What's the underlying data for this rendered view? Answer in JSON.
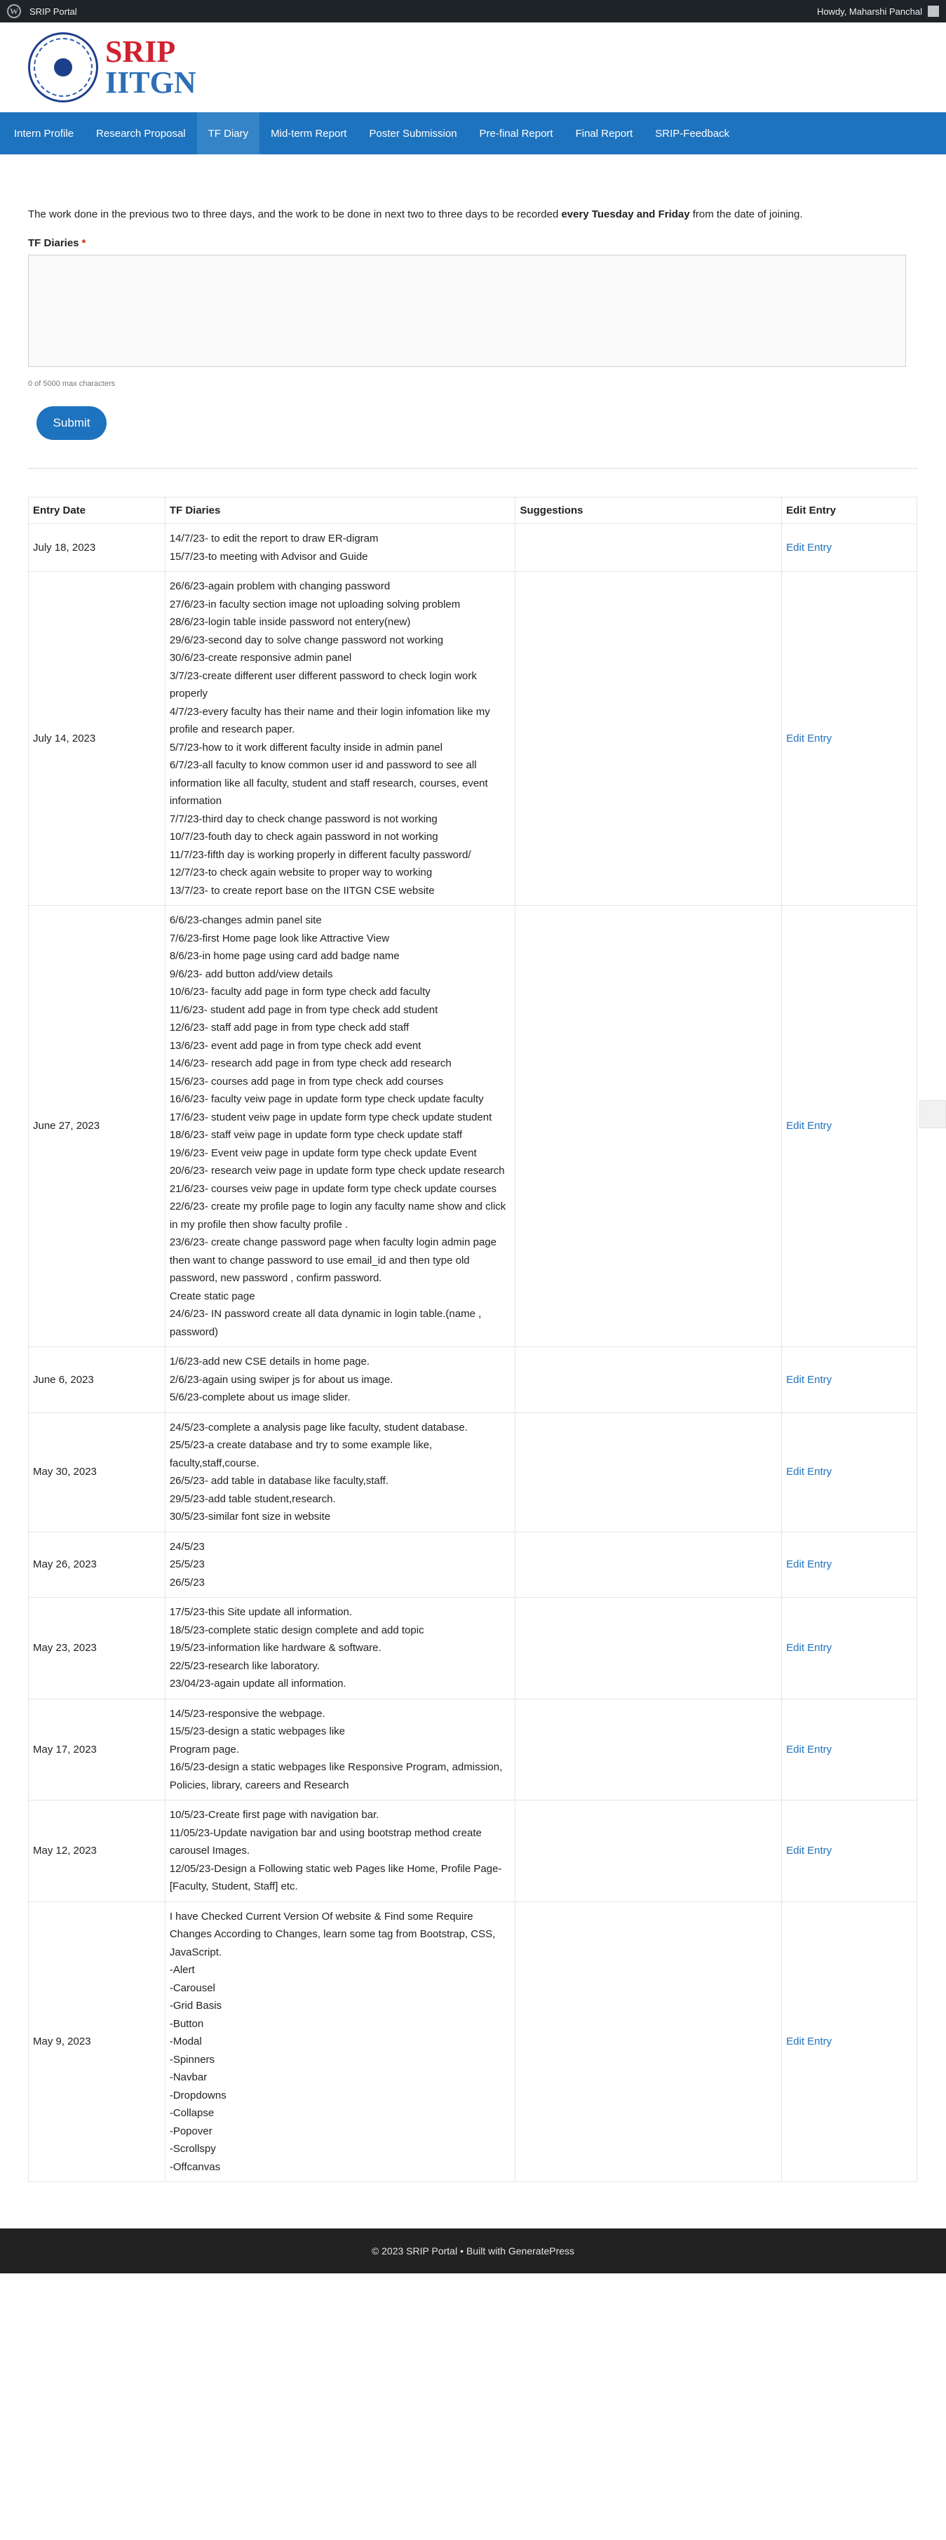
{
  "adminbar": {
    "site_name": "SRIP Portal",
    "greeting": "Howdy, Maharshi Panchal"
  },
  "header": {
    "logo_line1": "SRIP",
    "logo_line2": "IITGN"
  },
  "nav": [
    {
      "label": "Intern Profile"
    },
    {
      "label": "Research Proposal"
    },
    {
      "label": "TF Diary",
      "active": true
    },
    {
      "label": "Mid-term Report"
    },
    {
      "label": "Poster Submission"
    },
    {
      "label": "Pre-final Report"
    },
    {
      "label": "Final Report"
    },
    {
      "label": "SRIP-Feedback"
    }
  ],
  "form": {
    "intro_pre": "The work done in the previous two to three days, and the work to be done in next two to three days to be recorded ",
    "intro_bold": "every Tuesday and Friday",
    "intro_post": " from the date of joining.",
    "field_label": "TF Diaries",
    "required_mark": "*",
    "char_count": "0 of 5000 max characters",
    "submit_label": "Submit"
  },
  "table": {
    "headers": [
      "Entry Date",
      "TF Diaries",
      "Suggestions",
      "Edit Entry"
    ],
    "edit_label": "Edit Entry",
    "rows": [
      {
        "date": "July 18, 2023",
        "lines": [
          "14/7/23- to edit the report to draw ER-digram",
          "15/7/23-to meeting with Advisor and Guide"
        ]
      },
      {
        "date": "July 14, 2023",
        "lines": [
          "26/6/23-again problem with changing password",
          "27/6/23-in faculty section image not uploading solving problem",
          "28/6/23-login table inside password not entery(new)",
          "29/6/23-second day to solve change password not working",
          "30/6/23-create responsive admin panel",
          "3/7/23-create different user different password to check login work properly",
          "4/7/23-every faculty has their name and their login infomation like my profile and research paper.",
          "5/7/23-how to it work different faculty inside in admin panel",
          "6/7/23-all faculty to know common user id and password to see all information like all faculty, student and staff research, courses, event information",
          "7/7/23-third day to check change password is not working",
          "10/7/23-fouth day to check again password in not working",
          "11/7/23-fifth day is working properly in different faculty password/",
          "12/7/23-to check again website to proper way to working",
          "13/7/23- to create report base on the IITGN CSE website"
        ]
      },
      {
        "date": "June 27, 2023",
        "lines": [
          "6/6/23-changes admin panel site",
          "7/6/23-first Home page look like Attractive View",
          "8/6/23-in home page using card add badge name",
          "9/6/23- add button add/view details",
          "10/6/23- faculty add page in form type check add faculty",
          "11/6/23- student add page in from type check add student",
          "12/6/23- staff add page in from type check add staff",
          "13/6/23- event add page in from type check add event",
          "14/6/23- research add page in from type check add research",
          "15/6/23- courses add page in from type check add courses",
          "16/6/23- faculty veiw page in update form type check update faculty",
          "17/6/23- student veiw page in update form type check update student",
          "18/6/23- staff veiw page in update form type check update staff",
          "19/6/23- Event veiw page in update form type check update Event",
          "20/6/23- research veiw page in update form type check update research",
          "21/6/23- courses veiw page in update form type check update courses",
          "22/6/23- create my profile page to login any faculty name show and click in my profile then show faculty profile .",
          "23/6/23- create change password page when faculty login admin page then want to change password to use email_id and then type old password, new password , confirm password.",
          "Create static page",
          "24/6/23- IN password create all data dynamic in login table.(name , password)"
        ]
      },
      {
        "date": "June 6, 2023",
        "lines": [
          "1/6/23-add new CSE details in home page.",
          "2/6/23-again using swiper js for about us image.",
          "5/6/23-complete about us image slider."
        ]
      },
      {
        "date": "May 30, 2023",
        "lines": [
          "24/5/23-complete a analysis page like faculty, student database.",
          "25/5/23-a create database and try to some example like, faculty,staff,course.",
          "26/5/23- add table in database like faculty,staff.",
          "29/5/23-add table student,research.",
          "30/5/23-similar font size in website"
        ]
      },
      {
        "date": "May 26, 2023",
        "lines": [
          "24/5/23",
          "25/5/23",
          "26/5/23"
        ]
      },
      {
        "date": "May 23, 2023",
        "lines": [
          "17/5/23-this Site update all information.",
          "18/5/23-complete static design complete and add topic",
          "19/5/23-information like hardware & software.",
          "22/5/23-research like laboratory.",
          "23/04/23-again update all information."
        ]
      },
      {
        "date": "May 17, 2023",
        "lines": [
          "14/5/23-responsive the webpage.",
          "15/5/23-design a static webpages like",
          "Program page.",
          "16/5/23-design a static webpages like Responsive Program, admission, Policies, library, careers and Research"
        ]
      },
      {
        "date": "May 12, 2023",
        "lines": [
          "10/5/23-Create first page with navigation bar.",
          "11/05/23-Update navigation bar and using bootstrap method create carousel Images.",
          "12/05/23-Design a Following static web Pages like Home, Profile Page- [Faculty, Student, Staff] etc."
        ]
      },
      {
        "date": "May 9, 2023",
        "lines": [
          "I have Checked Current Version Of website & Find some Require Changes According to Changes, learn some tag from Bootstrap, CSS, JavaScript.",
          "-Alert",
          "-Carousel",
          "-Grid Basis",
          "-Button",
          "-Modal",
          "-Spinners",
          "-Navbar",
          "-Dropdowns",
          "-Collapse",
          "-Popover",
          "-Scrollspy",
          "-Offcanvas"
        ]
      }
    ]
  },
  "footer": {
    "copyright": "© 2023 SRIP Portal",
    "separator": "•",
    "built_with": "Built with GeneratePress"
  }
}
